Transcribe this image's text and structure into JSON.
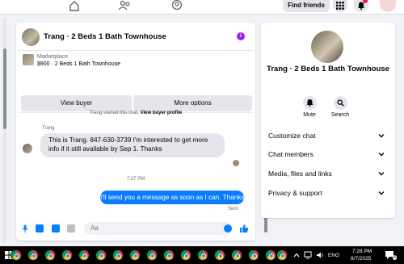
{
  "topbar": {
    "find_friends": "Find friends",
    "icons": [
      "home-icon",
      "friends-icon",
      "profile-icon",
      "menu-grid-icon",
      "notifications-icon"
    ]
  },
  "chat": {
    "header_title": "Trang · 2 Beds 1 Bath Townhouse",
    "listing": {
      "category": "Marketplace",
      "name": "$900 · 2 Beds 1 Bath Townhouse",
      "view_buyer": "View buyer",
      "more_options": "More options"
    },
    "started_text": "Trang started this chat.",
    "view_buyer_profile": "View buyer profile",
    "sender_name": "Trang",
    "incoming_message": "This is Trang. 847-630-3739 I'm interested to get more info if  it still available by Sep 1. Thanks",
    "time_separator": "7:27 PM",
    "outgoing_message": "I'll send you a message as soon as I can. Thanks",
    "sent_status": "Sent",
    "composer_placeholder": "Aa"
  },
  "info_panel": {
    "title": "Trang · 2 Beds 1 Bath Townhouse",
    "mute": "Mute",
    "search": "Search",
    "sections": [
      "Customize chat",
      "Chat members",
      "Media, files and links",
      "Privacy & support"
    ]
  },
  "taskbar": {
    "language": "ENG",
    "time": "7:28 PM",
    "date": "8/7/2025",
    "notification_count": "6"
  },
  "colors": {
    "accent": "#0a7cff",
    "info_purple": "#a020f0",
    "bubble_gray": "#e4e6eb"
  }
}
